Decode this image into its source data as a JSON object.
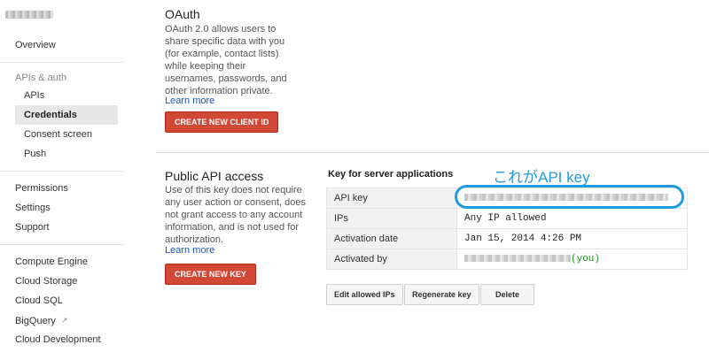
{
  "sidebar": {
    "overview": "Overview",
    "apis_auth_section": "APIs & auth",
    "apis": "APIs",
    "credentials": "Credentials",
    "consent_screen": "Consent screen",
    "push": "Push",
    "permissions": "Permissions",
    "settings": "Settings",
    "support": "Support",
    "compute_engine": "Compute Engine",
    "cloud_storage": "Cloud Storage",
    "cloud_sql": "Cloud SQL",
    "bigquery": "BigQuery",
    "cloud_development": "Cloud Development"
  },
  "oauth": {
    "title": "OAuth",
    "description": "OAuth 2.0 allows users to share specific data with you (for example, contact lists) while keeping their usernames, passwords, and other information private.",
    "learn_more": "Learn more",
    "button": "CREATE NEW CLIENT ID"
  },
  "public_api": {
    "title": "Public API access",
    "description": "Use of this key does not require any user action or consent, does not grant access to any account information, and is not used for authorization.",
    "learn_more": "Learn more",
    "button": "CREATE NEW KEY"
  },
  "server_key": {
    "heading": "Key for server applications",
    "rows": {
      "api_key_label": "API key",
      "ips_label": "IPs",
      "ips_value": "Any IP allowed",
      "activation_date_label": "Activation date",
      "activation_date_value": "Jan 15, 2014 4:26 PM",
      "activated_by_label": "Activated by",
      "activated_by_suffix": "(you)"
    },
    "buttons": {
      "edit_ips": "Edit allowed IPs",
      "regenerate": "Regenerate key",
      "delete": "Delete"
    }
  },
  "annotation": {
    "text": "これがAPI key",
    "color": "#1e9be0"
  }
}
